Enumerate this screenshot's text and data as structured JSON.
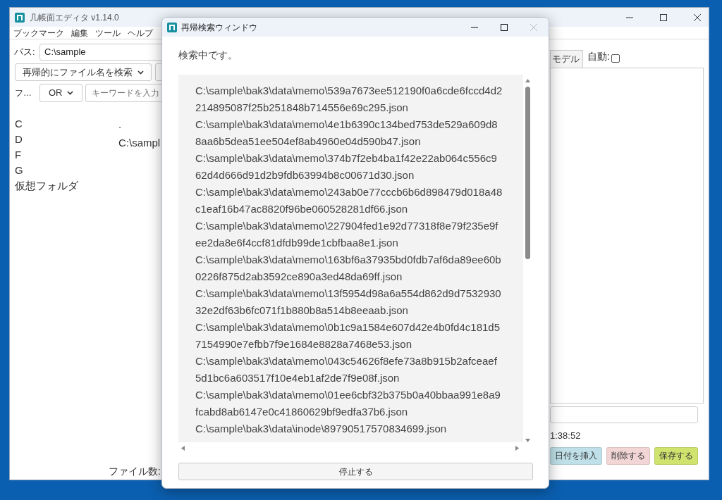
{
  "main_window": {
    "title": "几帳面エディタ v1.14.0",
    "menu": [
      "ブックマーク",
      "編集",
      "ツール",
      "ヘルプ"
    ],
    "path_label": "パス:",
    "path_value": "C:\\sample",
    "search_mode": "再帰的にファイル名を検索",
    "filter_label": "フ…",
    "operator": "OR",
    "keyword_placeholder": "キーワードを入力",
    "drives": [
      "C",
      "D",
      "F",
      "G",
      "仮想フォルダ"
    ],
    "listing": [
      ".",
      "C:\\sampl"
    ],
    "file_count_label": "ファイル数:",
    "tab": "モデル",
    "auto_label": "自動:",
    "auto_checked": false,
    "time": "1:38:52",
    "buttons": [
      {
        "label": "日付を挿入",
        "color": "#bfe0e8"
      },
      {
        "label": "削除する",
        "color": "#f2d6d6"
      },
      {
        "label": "保存する",
        "color": "#cfe36e"
      }
    ]
  },
  "dialog": {
    "title": "再帰検索ウィンドウ",
    "status": "検索中です。",
    "results": [
      "C:\\sample\\bak3\\data\\memo\\539a7673ee512190f0a6cde6fccd4d2214895087f25b251848b714556e69c295.json",
      "C:\\sample\\bak3\\data\\memo\\4e1b6390c134bed753de529a609d88aa6b5dea51ee504ef8ab4960e04d590b47.json",
      "C:\\sample\\bak3\\data\\memo\\374b7f2eb4ba1f42e22ab064c556c962d4d666d91d2b9fdb63994b8c00671d30.json",
      "C:\\sample\\bak3\\data\\memo\\243ab0e77cccb6b6d898479d018a48c1eaf16b47ac8820f96be060528281df66.json",
      "C:\\sample\\bak3\\data\\memo\\227904fed1e92d77318f8e79f235e9fee2da8e6f4ccf81dfdb99de1cbfbaa8e1.json",
      "C:\\sample\\bak3\\data\\memo\\163bf6a37935bd0fdb7af6da89ee60b0226f875d2ab3592ce890a3ed48da69ff.json",
      "C:\\sample\\bak3\\data\\memo\\13f5954d98a6a554d862d9d753293032e2df63b6fc071f1b880b8a514b8eeaab.json",
      "C:\\sample\\bak3\\data\\memo\\0b1c9a1584e607d42e4b0fd4c181d57154990e7efbb7f9e1684e8828a7468e53.json",
      "C:\\sample\\bak3\\data\\memo\\043c54626f8efe73a8b915b2afceaef5d1bc6a603517f10e4eb1af2de7f9e08f.json",
      "C:\\sample\\bak3\\data\\memo\\01ee6cbf32b375b0a40bbaa991e8a9fcabd8ab6147e0c41860629bf9edfa37b6.json",
      "C:\\sample\\bak3\\data\\inode\\89790517570834699.json"
    ],
    "stop_button": "停止する"
  }
}
